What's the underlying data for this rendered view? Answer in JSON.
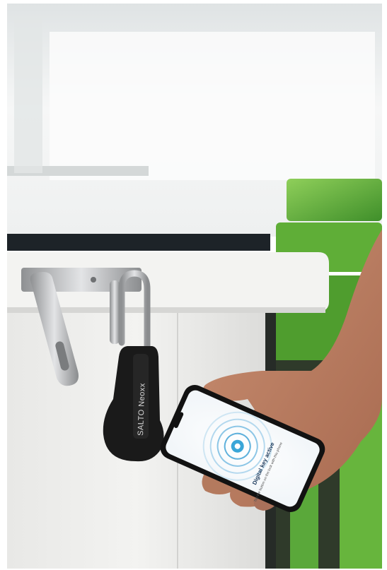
{
  "photo": {
    "description_alt": "",
    "lock_brand": "SALTO Neoxx",
    "phone_screen": {
      "title": "Digital key active",
      "subtitle": "Tap the button on the lock with this phone"
    },
    "colors": {
      "counter_white": "#f2f2f0",
      "counter_edge": "#e9e9e7",
      "counter_top_dark": "#1d2328",
      "chair_green": "#6fbf3a",
      "lock_black": "#1a1a1a",
      "hasp_steel": "#b9babc",
      "skin": "#b77f63",
      "phone_frame": "#121212",
      "screen_blue": "#3aa6d8"
    }
  }
}
